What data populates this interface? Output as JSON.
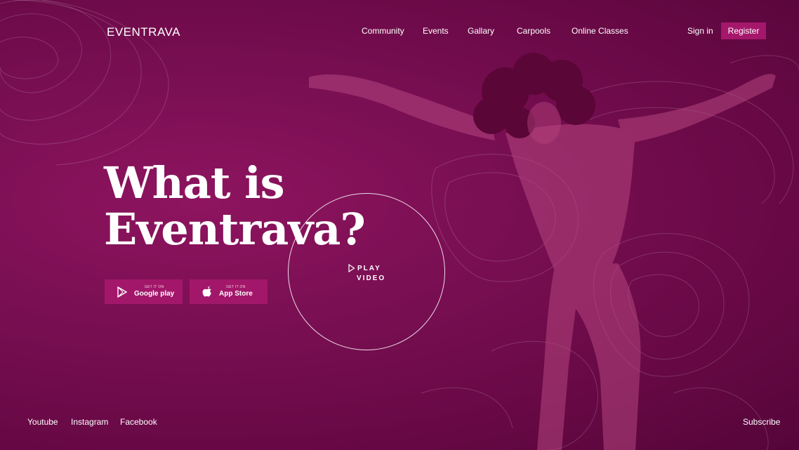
{
  "brand": {
    "name": "EVENTRAVA"
  },
  "nav": {
    "items": [
      {
        "label": "Community"
      },
      {
        "label": "Events"
      },
      {
        "label": "Gallary"
      },
      {
        "label": "Carpools"
      },
      {
        "label": "Online Classes"
      }
    ],
    "sign_in": "Sign in",
    "register": "Register"
  },
  "hero": {
    "headline_line1": "What is",
    "headline_line2": "Eventrava?",
    "play_line1": "PLAY",
    "play_line2": "VIDEO"
  },
  "store_buttons": {
    "google": {
      "small": "GET IT ON",
      "big": "Google play"
    },
    "apple": {
      "small": "GET IT ON",
      "big": "App Store"
    }
  },
  "footer": {
    "social": [
      "Youtube",
      "Instagram",
      "Facebook"
    ],
    "subscribe": "Subscribe"
  },
  "colors": {
    "background": "#7a0f53",
    "accent": "#a5176b",
    "text": "#ffffff"
  }
}
